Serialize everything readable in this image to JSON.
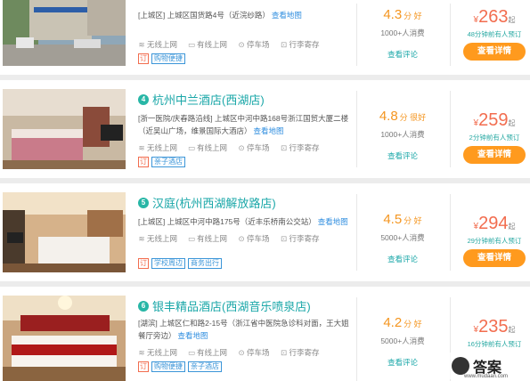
{
  "hotels": [
    {
      "rank": "",
      "name": "",
      "address": "[上城区] 上城区国货路4号（近浣纱路）",
      "map_link": "查看地图",
      "amenities": [
        "无线上网",
        "有线上网",
        "停车场",
        "行李寄存"
      ],
      "tag_ding": "订",
      "tags": [
        "购物便捷"
      ],
      "score": "4.3",
      "score_unit": "分 好",
      "consumed": "1000+人消费",
      "review_link": "查看评论",
      "price_symbol": "¥",
      "price": "263",
      "price_suffix": "起",
      "booked": "48分钟前有人预订",
      "detail_label": "查看详情"
    },
    {
      "rank": "4",
      "name": "杭州中兰酒店(西湖店)",
      "address": "[浙一医院/庆春路沿线] 上城区中河中路168号浙江国贸大厦二楼（近吴山广场，维景国际大酒店）",
      "map_link": "查看地图",
      "amenities": [
        "无线上网",
        "有线上网",
        "停车场",
        "行李寄存"
      ],
      "tag_ding": "订",
      "tags": [
        "亲子酒店"
      ],
      "score": "4.8",
      "score_unit": "分 很好",
      "consumed": "1000+人消费",
      "review_link": "查看评论",
      "price_symbol": "¥",
      "price": "259",
      "price_suffix": "起",
      "booked": "2分钟前有人预订",
      "detail_label": "查看详情"
    },
    {
      "rank": "5",
      "name": "汉庭(杭州西湖解放路店)",
      "address": "[上城区] 上城区中河中路175号（近丰乐桥南公交站）",
      "map_link": "查看地图",
      "amenities": [
        "无线上网",
        "有线上网",
        "停车场",
        "行李寄存"
      ],
      "tag_ding": "订",
      "tags": [
        "学校周边",
        "商务出行"
      ],
      "score": "4.5",
      "score_unit": "分 好",
      "consumed": "5000+人消费",
      "review_link": "查看评论",
      "price_symbol": "¥",
      "price": "294",
      "price_suffix": "起",
      "booked": "29分钟前有人预订",
      "detail_label": "查看详情"
    },
    {
      "rank": "6",
      "name": "银丰精品酒店(西湖音乐喷泉店)",
      "address": "[湖滨] 上城区仁和路2-15号（浙江省中医院急诊科对面，王大姐餐厅旁边）",
      "map_link": "查看地图",
      "amenities": [
        "无线上网",
        "有线上网",
        "停车场",
        "行李寄存"
      ],
      "tag_ding": "订",
      "tags": [
        "购物便捷",
        "亲子酒店"
      ],
      "score": "4.2",
      "score_unit": "分 好",
      "consumed": "5000+人消费",
      "review_link": "查看评论",
      "price_symbol": "¥",
      "price": "235",
      "price_suffix": "起",
      "booked": "16分钟前有人预订",
      "detail_label": "查看详情"
    }
  ],
  "watermark": {
    "text": "答案",
    "url": "www.mudaan.com"
  },
  "colors": {
    "accent": "#1aa7a8",
    "price": "#f26d4f",
    "score": "#f4951f",
    "button": "#ff9a1e",
    "tag": "#3b95d8"
  }
}
